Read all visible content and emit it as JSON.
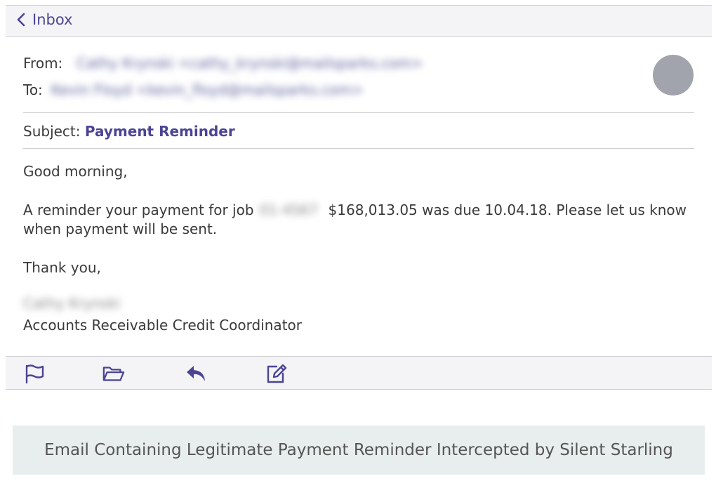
{
  "nav": {
    "back_label": "Inbox"
  },
  "header": {
    "from_label": "From:",
    "from_value": "Cathy Krynski <cathy_krynski@mailsparks.com>",
    "to_label": "To:",
    "to_value": "Kevin Floyd <kevin_floyd@mailsparks.com>",
    "subject_label": "Subject:",
    "subject_value": "Payment Reminder"
  },
  "body": {
    "greeting": "Good morning,",
    "line1_prefix": "A reminder your payment for job",
    "job_number": "01-4567",
    "line1_suffix": "$168,013.05 was due 10.04.18. Please let us know when payment will be sent.",
    "closing": "Thank you,",
    "signature_name": "Cathy Krynski",
    "signature_title": "Accounts Receivable Credit Coordinator"
  },
  "toolbar": {
    "icons": [
      "flag-icon",
      "folder-icon",
      "reply-icon",
      "compose-icon"
    ],
    "accent": "#4b4494"
  },
  "caption": "Email Containing Legitimate Payment Reminder Intercepted by Silent Starling"
}
